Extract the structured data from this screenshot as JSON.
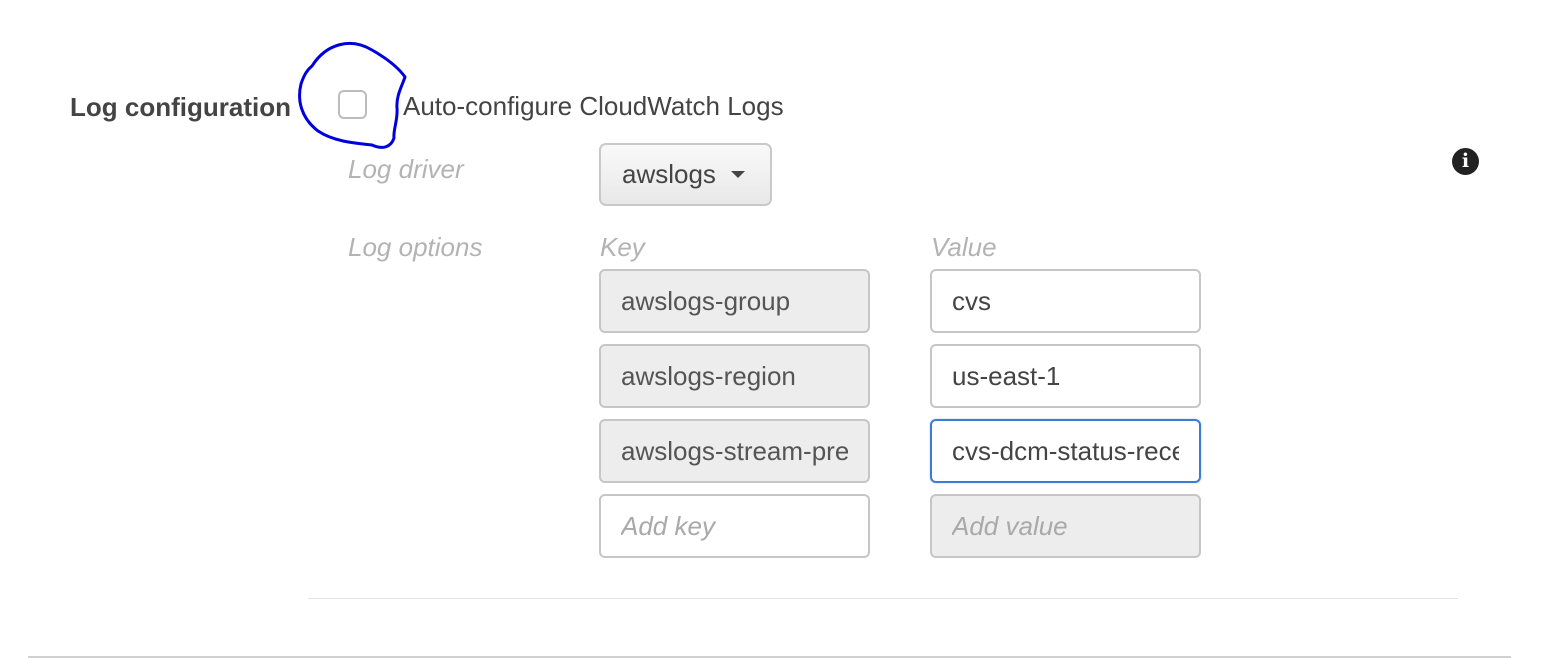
{
  "section": {
    "title": "Log configuration",
    "auto_configure": {
      "label": "Auto-configure CloudWatch Logs",
      "checked": false
    }
  },
  "log_driver": {
    "label": "Log driver",
    "selected": "awslogs"
  },
  "log_options": {
    "label": "Log options",
    "key_header": "Key",
    "value_header": "Value",
    "rows": [
      {
        "key": "awslogs-group",
        "value": "cvs"
      },
      {
        "key": "awslogs-region",
        "value": "us-east-1"
      },
      {
        "key": "awslogs-stream-prefix",
        "value": "cvs-dcm-status-receiver"
      }
    ],
    "add_key_placeholder": "Add key",
    "add_value_placeholder": "Add value"
  },
  "icons": {
    "info": "info-icon",
    "dropdown": "caret-down-icon"
  },
  "colors": {
    "annotation": "#0000dd",
    "focus_border": "#3a7dd2"
  }
}
